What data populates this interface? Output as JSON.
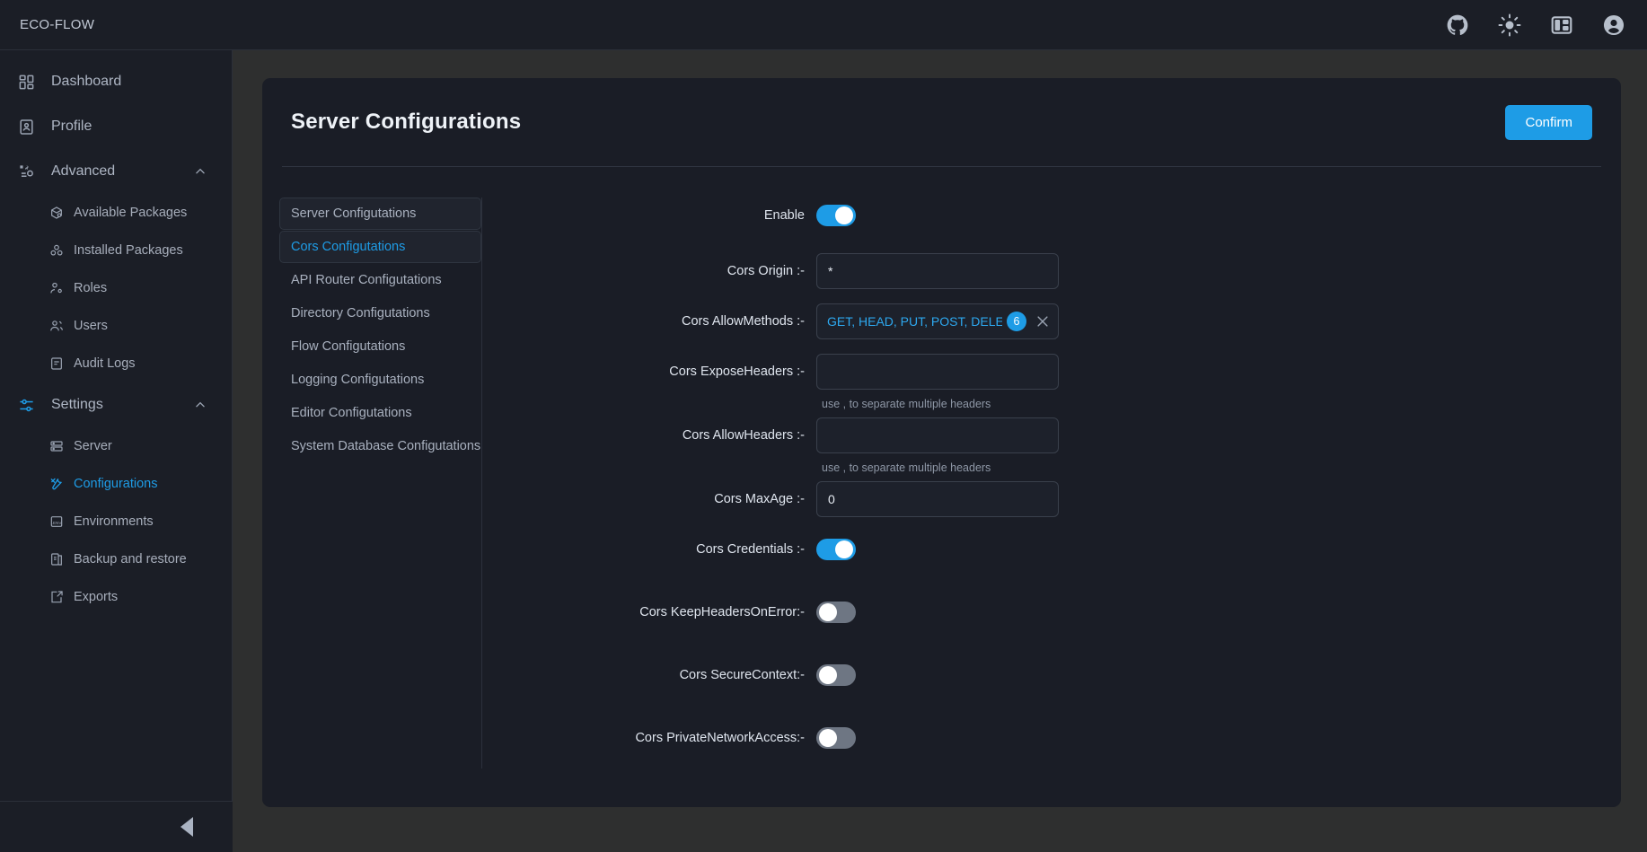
{
  "app": {
    "brand": "ECO-FLOW",
    "accent": "#1e9ce6",
    "topbar_icons": [
      {
        "name": "github-icon",
        "label": "GitHub"
      },
      {
        "name": "sun-icon",
        "label": "Toggle theme"
      },
      {
        "name": "layout-panel-icon",
        "label": "Toggle panel"
      },
      {
        "name": "account-avatar-icon",
        "label": "Account"
      }
    ]
  },
  "sidebar": {
    "items": [
      {
        "label": "Dashboard",
        "icon": "dashboard-grid-icon",
        "type": "item",
        "active": false
      },
      {
        "label": "Profile",
        "icon": "profile-card-icon",
        "type": "item",
        "active": false
      },
      {
        "label": "Advanced",
        "icon": "advanced-gear-icon",
        "type": "group",
        "expanded": true
      },
      {
        "label": "Available Packages",
        "icon": "package-search-icon",
        "type": "sub",
        "active": false
      },
      {
        "label": "Installed Packages",
        "icon": "packages-stack-icon",
        "type": "sub",
        "active": false
      },
      {
        "label": "Roles",
        "icon": "role-user-icon",
        "type": "sub",
        "active": false
      },
      {
        "label": "Users",
        "icon": "users-icon",
        "type": "sub",
        "active": false
      },
      {
        "label": "Audit Logs",
        "icon": "audit-log-icon",
        "type": "sub",
        "active": false
      },
      {
        "label": "Settings",
        "icon": "settings-sliders-icon",
        "type": "group",
        "expanded": true
      },
      {
        "label": "Server",
        "icon": "server-icon",
        "type": "sub",
        "active": false
      },
      {
        "label": "Configurations",
        "icon": "tools-wrench-icon",
        "type": "sub",
        "active": true
      },
      {
        "label": "Environments",
        "icon": "env-file-icon",
        "type": "sub",
        "active": false
      },
      {
        "label": "Backup and restore",
        "icon": "backup-icon",
        "type": "sub",
        "active": false
      },
      {
        "label": "Exports",
        "icon": "export-icon",
        "type": "sub",
        "active": false
      }
    ],
    "collapse_icon": "collapse-left-arrow-icon"
  },
  "page": {
    "title": "Server Configurations",
    "confirm_label": "Confirm"
  },
  "tabs": [
    {
      "label": "Server Configutations",
      "style": "boxed",
      "active": false
    },
    {
      "label": "Cors Configutations",
      "style": "boxed",
      "active": true
    },
    {
      "label": "API Router Configutations",
      "style": "plain",
      "active": false
    },
    {
      "label": "Directory Configutations",
      "style": "plain",
      "active": false
    },
    {
      "label": "Flow Configutations",
      "style": "plain",
      "active": false
    },
    {
      "label": "Logging Configutations",
      "style": "plain",
      "active": false
    },
    {
      "label": "Editor Configutations",
      "style": "plain",
      "active": false
    },
    {
      "label": "System Database Configutations",
      "style": "plain",
      "active": false
    }
  ],
  "form": {
    "enable": {
      "label": "Enable",
      "value": true
    },
    "cors_origin": {
      "label": "Cors Origin :-",
      "value": "*"
    },
    "cors_allow_methods": {
      "label": "Cors AllowMethods :-",
      "display": "GET, HEAD, PUT, POST, DELETE, PA...",
      "count": "6",
      "clear_icon": "clear-x-icon"
    },
    "cors_expose_headers": {
      "label": "Cors ExposeHeaders :-",
      "value": "",
      "hint": "use , to separate multiple headers"
    },
    "cors_allow_headers": {
      "label": "Cors AllowHeaders :-",
      "value": "",
      "hint": "use , to separate multiple headers"
    },
    "cors_max_age": {
      "label": "Cors MaxAge :-",
      "value": "0"
    },
    "cors_credentials": {
      "label": "Cors Credentials :-",
      "value": true
    },
    "cors_keep_headers_on_error": {
      "label": "Cors KeepHeadersOnError:-",
      "value": false
    },
    "cors_secure_context": {
      "label": "Cors SecureContext:-",
      "value": false
    },
    "cors_private_network_access": {
      "label": "Cors PrivateNetworkAccess:-",
      "value": false
    }
  }
}
